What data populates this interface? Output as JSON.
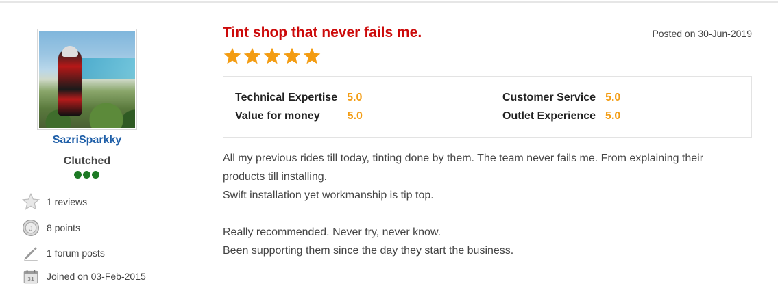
{
  "reviewer": {
    "username": "SazriSparkky",
    "rank": "Clutched",
    "rank_dots": 3,
    "stats": [
      {
        "icon": "star-outline-icon",
        "text": "1 reviews"
      },
      {
        "icon": "coin-icon",
        "text": "8 points"
      },
      {
        "icon": "pencil-icon",
        "text": "1 forum posts"
      },
      {
        "icon": "calendar-icon",
        "text": "Joined on 03-Feb-2015"
      }
    ]
  },
  "review": {
    "title": "Tint shop that never fails me.",
    "posted": "Posted on 30-Jun-2019",
    "stars": 5,
    "ratings": [
      {
        "label": "Technical Expertise",
        "value": "5.0"
      },
      {
        "label": "Customer Service",
        "value": "5.0"
      },
      {
        "label": "Value for money",
        "value": "5.0"
      },
      {
        "label": "Outlet Experience",
        "value": "5.0"
      }
    ],
    "body": [
      "All my previous rides till today, tinting done by them. The team never fails me. From explaining their",
      "products till installing.",
      "Swift installation yet workmanship is tip top.",
      "",
      "Really recommended. Never try, never know.",
      "Been supporting them since the day they start the business."
    ]
  },
  "colors": {
    "accent": "#cc0a0a",
    "star": "#f39c12",
    "link": "#1f5fa8",
    "dots": "#1c7a24"
  }
}
